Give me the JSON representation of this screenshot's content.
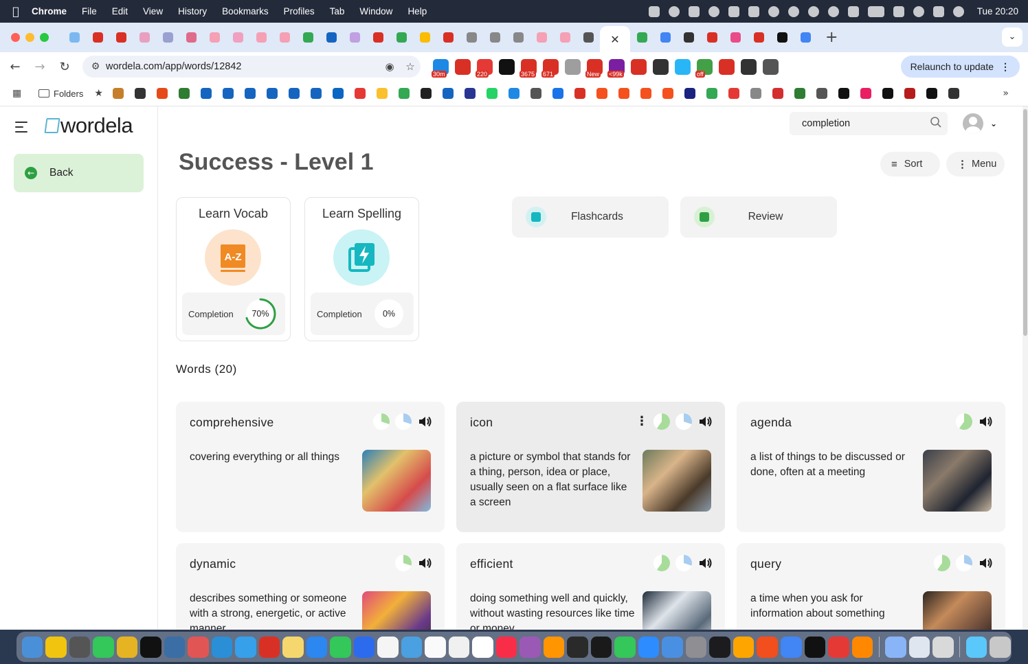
{
  "system_menu": {
    "app_name": "Chrome",
    "items": [
      "File",
      "Edit",
      "View",
      "History",
      "Bookmarks",
      "Profiles",
      "Tab",
      "Window",
      "Help"
    ],
    "clock": "Tue 20:20"
  },
  "browser": {
    "url": "wordela.com/app/words/12842",
    "relaunch_label": "Relaunch to update",
    "bookmarks_folder_label": "Folders",
    "tab_favicon_colors": [
      "#7bb8f0",
      "#d93025",
      "#d93025",
      "#e9a0c0",
      "#9aa0d0",
      "#e06a8a",
      "#f5a0b5",
      "#f0a0c0",
      "#f5a0b5",
      "#f5a0b5",
      "#34a853",
      "#1565c0",
      "#c0a0e0",
      "#d93025",
      "#34a853",
      "#fbbc04",
      "#d93025",
      "#888888",
      "#888888",
      "#888888",
      "#f5a0b5",
      "#f5a0b5",
      "#555555"
    ],
    "after_active_tab_colors": [
      "#34a853",
      "#4285f4",
      "#333333",
      "#d93025",
      "#ea4c89",
      "#d93025",
      "#111111",
      "#4285f4"
    ],
    "extension_colors": [
      "#1e88e5",
      "#d93025",
      "#e53935",
      "#111111",
      "#d93025",
      "#d93025",
      "#9e9e9e",
      "#d93025",
      "#7b1fa2",
      "#d93025",
      "#333333",
      "#29b6f6",
      "#43a047",
      "#d93025",
      "#333333",
      "#555555"
    ],
    "extension_badges": [
      "30m",
      "",
      "220",
      "",
      "3675",
      "671",
      "",
      "New",
      "<99k",
      "",
      "",
      "",
      "off",
      "",
      "",
      ""
    ],
    "bookmark_colors": [
      "#c57f2a",
      "#333333",
      "#e64a19",
      "#2e7d32",
      "#1565c0",
      "#1565c0",
      "#1565c0",
      "#1565c0",
      "#1565c0",
      "#1565c0",
      "#0a66c2",
      "#e53935",
      "#fbc02d",
      "#34a853",
      "#222222",
      "#1565c0",
      "#283593",
      "#25d366",
      "#1e88e5",
      "#555555",
      "#1a73e8",
      "#d93025",
      "#f4511e",
      "#f4511e",
      "#f4511e",
      "#f4511e",
      "#1a237e",
      "#34a853",
      "#e53935",
      "#888888",
      "#d32f2f",
      "#2e7d32",
      "#555555",
      "#111111",
      "#e91e63",
      "#111111",
      "#b71c1c",
      "#111111",
      "#333333"
    ]
  },
  "sidebar": {
    "logo_text": "wordela",
    "back_label": "Back"
  },
  "header": {
    "search_value": "completion",
    "sort_label": "Sort",
    "menu_label": "Menu"
  },
  "page_title": "Success - Level 1",
  "learn_cards": [
    {
      "title": "Learn Vocab",
      "completion_label": "Completion",
      "percent_text": "70%",
      "progress": 0.7,
      "icon_bg": "#fde3cc",
      "icon_color": "#f08a24",
      "icon_text": "A-Z"
    },
    {
      "title": "Learn Spelling",
      "completion_label": "Completion",
      "percent_text": "0%",
      "progress": 0,
      "icon_bg": "#c9f3f5",
      "icon_color": "#16b7c0",
      "icon_text": ""
    }
  ],
  "actions": [
    {
      "label": "Flashcards",
      "icon_bg": "#d4f1f2",
      "icon_color": "#16b7c0"
    },
    {
      "label": "Review",
      "icon_bg": "#d8f1d4",
      "icon_color": "#2ea043"
    }
  ],
  "words_heading": "Words (20)",
  "words": [
    {
      "term": "comprehensive",
      "definition": "covering everything or all things",
      "pies": [
        0.3,
        0.3
      ],
      "image_colors": [
        "#2b7fb8",
        "#e2c16b",
        "#d64b4b",
        "#7fbbe0"
      ]
    },
    {
      "term": "icon",
      "definition": "a picture or symbol that stands for a thing, person, idea or place, usually seen on a flat surface like a screen",
      "pies": [
        0.6,
        0.3
      ],
      "image_colors": [
        "#6b7a5a",
        "#d9b48a",
        "#4a3a2a",
        "#8a9aa8"
      ]
    },
    {
      "term": "agenda",
      "definition": "a list of things to be discussed or done, often at a meeting",
      "pies": [
        0.6
      ],
      "image_colors": [
        "#3a3f4a",
        "#8a7a6a",
        "#1f2430",
        "#c9b8a0"
      ]
    },
    {
      "term": "dynamic",
      "definition": "describes something or someone with a strong, energetic, or active manner",
      "pies": [
        0.3
      ],
      "image_colors": [
        "#e04a7a",
        "#f2b03a",
        "#6a3a8a",
        "#3a2a2a"
      ]
    },
    {
      "term": "efficient",
      "definition": "doing something well and quickly, without wasting resources like time or money",
      "pies": [
        0.6,
        0.3
      ],
      "image_colors": [
        "#1d2a3a",
        "#dfe4ea",
        "#5a6a7a",
        "#f0f0f0"
      ]
    },
    {
      "term": "query",
      "definition": "a time when you ask for information about something",
      "pies": [
        0.6,
        0.3
      ],
      "image_colors": [
        "#2a2520",
        "#c48a5a",
        "#6a4a3a",
        "#1a1512"
      ]
    }
  ],
  "dock_colors": [
    "#4a90d9",
    "#f1c40f",
    "#555555",
    "#34c759",
    "#e6b422",
    "#111111",
    "#3a6ea5",
    "#e25555",
    "#2a8fd6",
    "#36a0ea",
    "#d93025",
    "#f5d76e",
    "#2c87f0",
    "#34c759",
    "#2c6bed",
    "#f5f5f5",
    "#4aa0e0",
    "#fafafa",
    "#f0f0f0",
    "#ffffff",
    "#fa2d48",
    "#9b59b6",
    "#ff9500",
    "#2a2a2a",
    "#1a1a1a",
    "#34c759",
    "#2d8cff",
    "#4a90e2",
    "#8e8e93",
    "#1c1c1e",
    "#ffa500",
    "#f24e1e",
    "#4285f4",
    "#111111",
    "#e53935",
    "#ff8800",
    "#8ab4f8",
    "#dfe6ef",
    "#d9d9d9",
    "#5ac8fa",
    "#c8c8c8"
  ]
}
